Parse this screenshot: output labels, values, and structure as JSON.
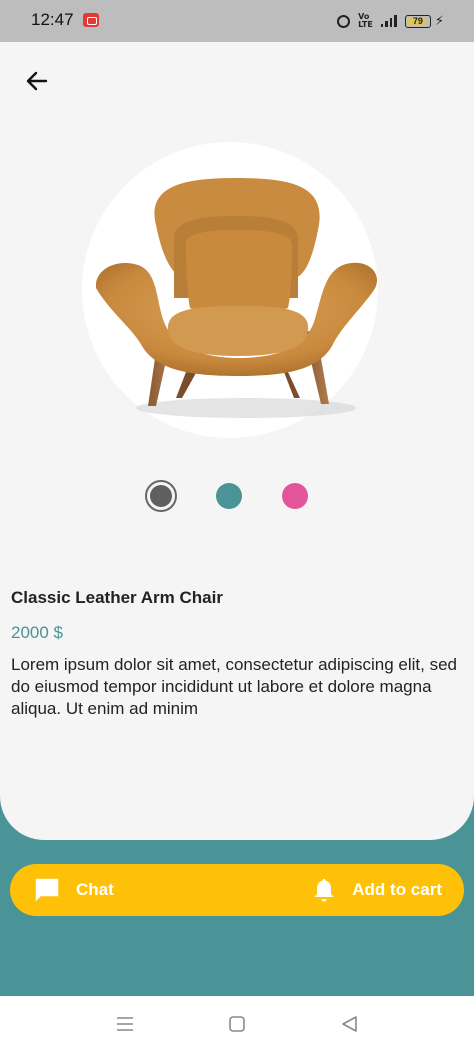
{
  "status_bar": {
    "time": "12:47",
    "volte": "Vo LTE",
    "battery_level": "79"
  },
  "product": {
    "title": "Classic Leather Arm Chair",
    "price": "2000 $",
    "description": "Lorem ipsum dolor sit amet, consectetur adipiscing elit, sed do eiusmod tempor incididunt ut labore et dolore magna aliqua. Ut enim ad minim",
    "colors": [
      {
        "name": "gray",
        "hex": "#5f5f5f",
        "selected": true
      },
      {
        "name": "teal",
        "hex": "#4a9396",
        "selected": false
      },
      {
        "name": "pink",
        "hex": "#e2559a",
        "selected": false
      }
    ]
  },
  "actions": {
    "chat_label": "Chat",
    "cart_label": "Add to cart",
    "chat_icon": "chat-bubble-icon",
    "cart_icon": "bell-icon"
  },
  "theme": {
    "accent": "#4a9396",
    "button": "#ffc107",
    "card": "#f5f5f5"
  }
}
